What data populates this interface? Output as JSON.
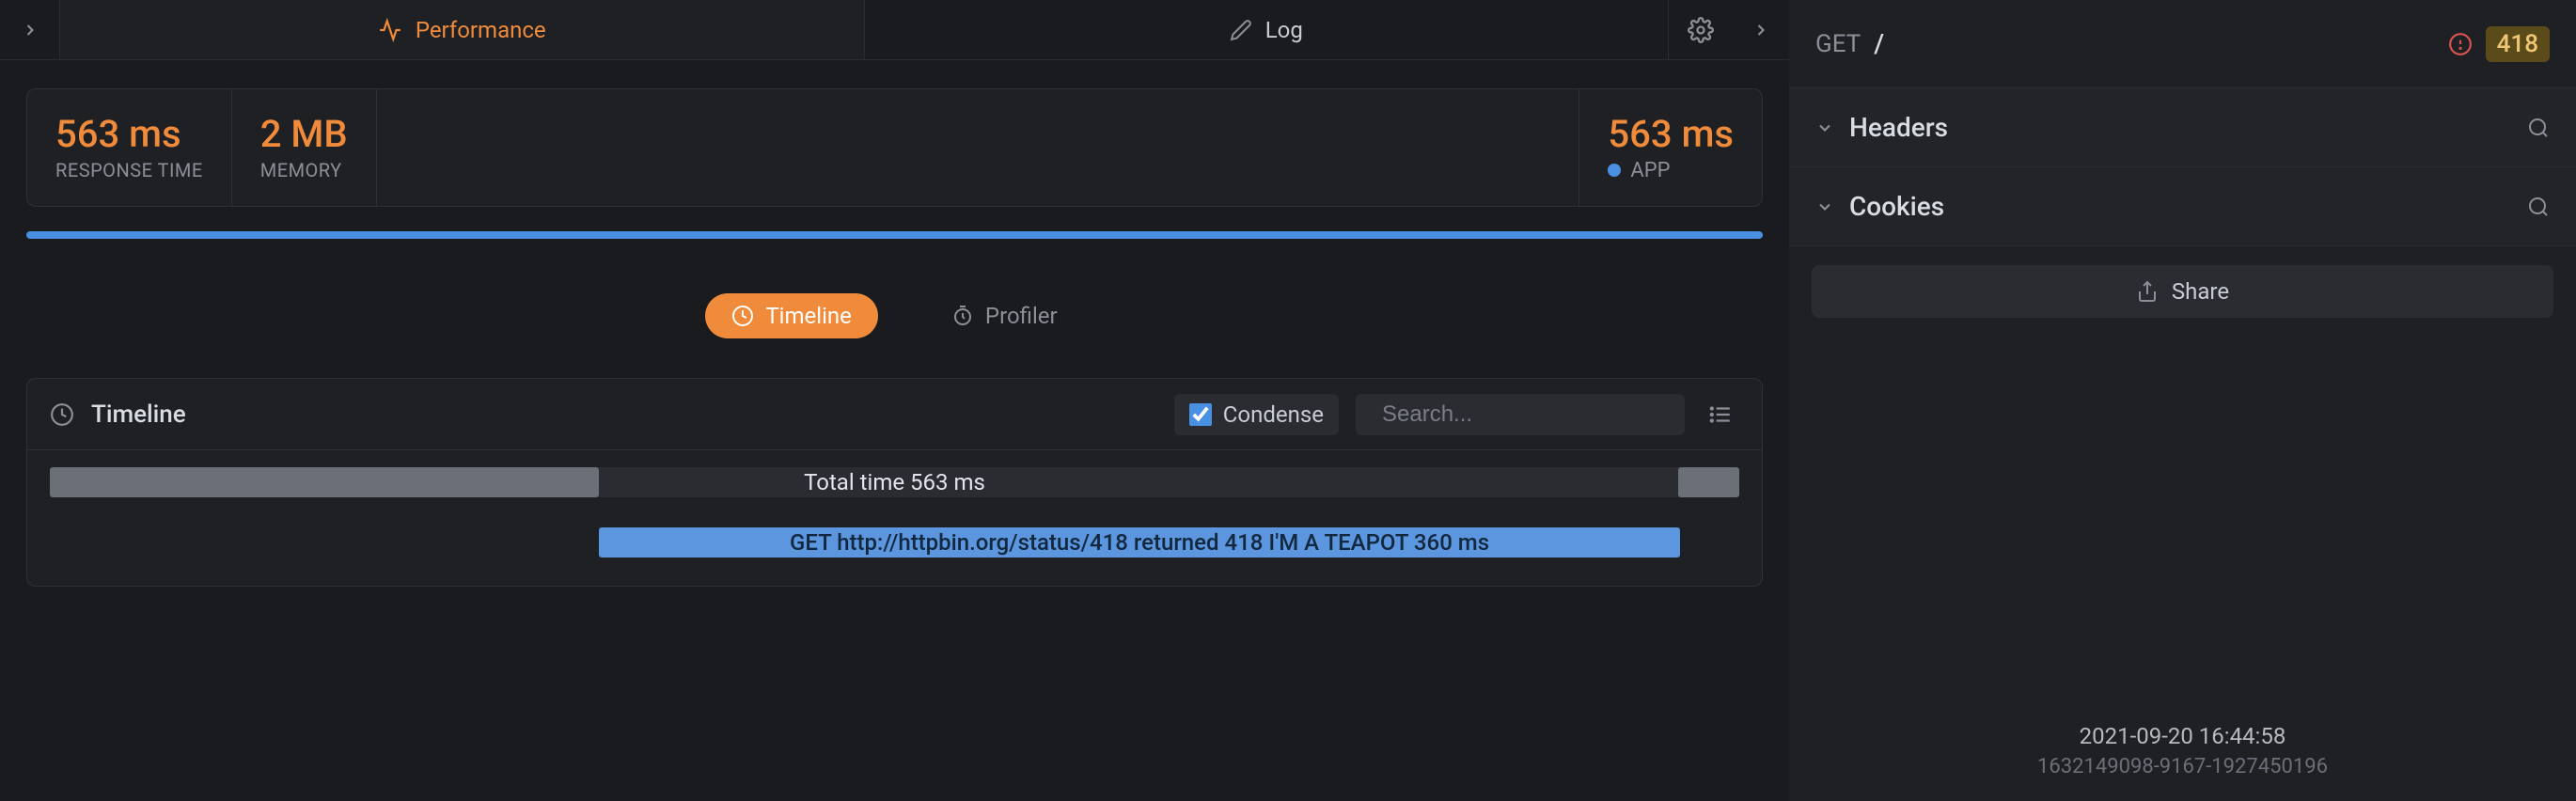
{
  "tabs": {
    "performance": "Performance",
    "log": "Log"
  },
  "stats": {
    "response_time_value": "563 ms",
    "response_time_label": "RESPONSE TIME",
    "memory_value": "2 MB",
    "memory_label": "MEMORY",
    "app_time_value": "563 ms",
    "app_label": "APP"
  },
  "subtabs": {
    "timeline": "Timeline",
    "profiler": "Profiler"
  },
  "panel": {
    "title": "Timeline",
    "condense": "Condense",
    "search_placeholder": "Search..."
  },
  "timeline": {
    "total_text": "Total time 563 ms",
    "event_text": "GET http://httpbin.org/status/418 returned 418 I'M A TEAPOT 360 ms"
  },
  "sidebar": {
    "method": "GET",
    "path": "/",
    "status_code": "418",
    "headers": "Headers",
    "cookies": "Cookies",
    "share": "Share",
    "timestamp": "2021-09-20 16:44:58",
    "request_id": "1632149098-9167-1927450196"
  },
  "colors": {
    "accent_orange": "#ef8b3a",
    "bar_blue": "#4a90e2",
    "bar_grey": "#6b6f77"
  }
}
